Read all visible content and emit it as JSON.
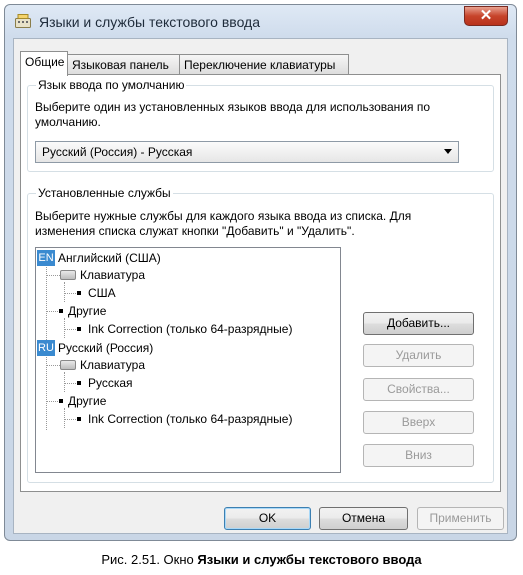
{
  "window": {
    "title": "Языки и службы текстового ввода",
    "close_glyph": "✕"
  },
  "tabs": [
    {
      "label": "Общие"
    },
    {
      "label": "Языковая панель"
    },
    {
      "label": "Переключение клавиатуры"
    }
  ],
  "default_lang": {
    "legend": "Язык ввода по умолчанию",
    "description_line1": "Выберите один из установленных языков ввода для использования по",
    "description_line2": "умолчанию.",
    "selected": "Русский (Россия) - Русская"
  },
  "services": {
    "legend": "Установленные службы",
    "description_line1": "Выберите нужные службы для каждого языка ввода из списка. Для",
    "description_line2": "изменения списка служат кнопки \"Добавить\" и \"Удалить\".",
    "tree": {
      "en": {
        "badge": "EN",
        "label": "Английский (США)",
        "keyboard": "Клавиатура",
        "layout": "США",
        "other": "Другие",
        "ink": "Ink Correction (только 64-разрядные)"
      },
      "ru": {
        "badge": "RU",
        "label": "Русский (Россия)",
        "keyboard": "Клавиатура",
        "layout": "Русская",
        "other": "Другие",
        "ink": "Ink Correction (только 64-разрядные)"
      }
    },
    "buttons": {
      "add": "Добавить...",
      "remove": "Удалить",
      "properties": "Свойства...",
      "up": "Вверх",
      "down": "Вниз"
    }
  },
  "footer": {
    "ok": "OK",
    "cancel": "Отмена",
    "apply": "Применить"
  },
  "caption": {
    "prefix": "Рис. 2.51. Окно ",
    "bold": "Языки и службы текстового ввода"
  }
}
